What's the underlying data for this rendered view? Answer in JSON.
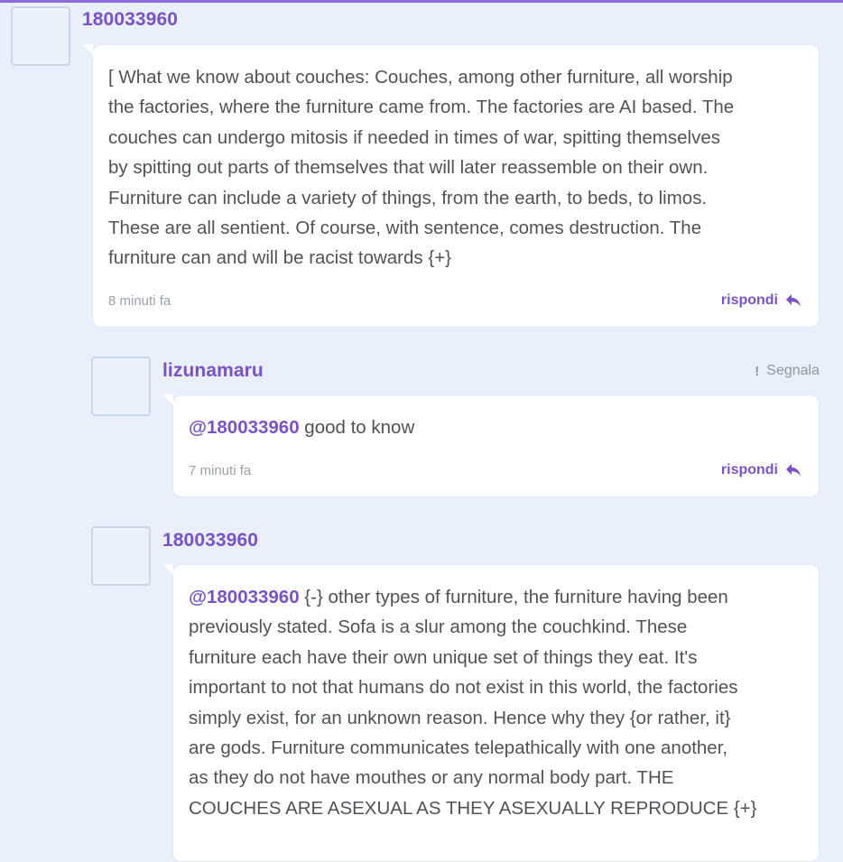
{
  "comments": [
    {
      "username": "180033960",
      "text_lines": [
        "[ What we know about couches: Couches, among other furniture, all worship",
        "the factories, where the furniture came from. The factories are AI based. The",
        "couches can undergo mitosis if needed in times of war, spitting themselves",
        "by spitting out parts of themselves that will later reassemble on their own.",
        "Furniture can include a variety of things, from the earth, to beds, to limos.",
        "These are all sentient. Of course, with sentence, comes destruction. The",
        "furniture can and will be racist towards {+}"
      ],
      "time": "8 minuti fa",
      "reply_label": "rispondi"
    },
    {
      "username": "lizunamaru",
      "report_label": "Segnala",
      "mention": "@180033960",
      "text": " good to know",
      "time": "7 minuti fa",
      "reply_label": "rispondi"
    },
    {
      "username": "180033960",
      "mention": "@180033960",
      "first_line_rest": " {-} other types of furniture, the furniture having been",
      "text_lines": [
        "previously stated. Sofa is a slur among the couchkind. These",
        "furniture each have their own unique set of things they eat. It's",
        "important to not that humans do not exist in this world, the factories",
        "simply exist, for an unknown reason. Hence why they {or rather, it}",
        "are gods. Furniture communicates telepathically with one another,",
        "as they do not have mouthes or any normal body part. THE",
        "COUCHES ARE ASEXUAL AS THEY ASEXUALLY REPRODUCE {+}"
      ]
    }
  ],
  "colors": {
    "accent": "#7a52c7",
    "background": "#e9f0fb",
    "card": "#ffffff",
    "text": "#4f5358",
    "muted": "#9aa3ad"
  },
  "icons": {
    "reply": "reply-arrow-icon",
    "report": "exclamation-icon"
  }
}
